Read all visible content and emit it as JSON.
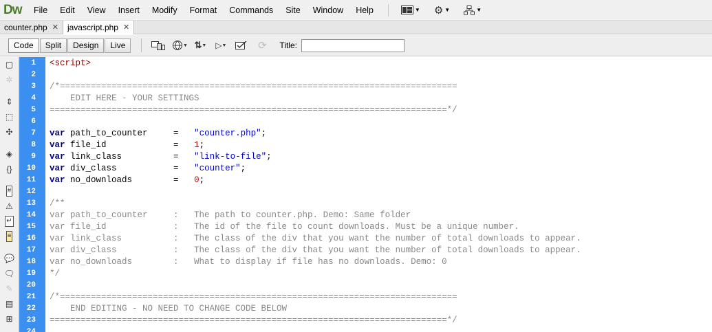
{
  "app": {
    "logo": "Dw",
    "menu": [
      "File",
      "Edit",
      "View",
      "Insert",
      "Modify",
      "Format",
      "Commands",
      "Site",
      "Window",
      "Help"
    ],
    "menu_icons": [
      "layout-icon",
      "gear-icon",
      "site-icon"
    ]
  },
  "tabs": [
    {
      "label": "counter.php",
      "active": false
    },
    {
      "label": "javascript.php",
      "active": true
    }
  ],
  "doc_toolbar": {
    "views": [
      "Code",
      "Split",
      "Design",
      "Live"
    ],
    "active_view": "Code",
    "title_label": "Title:",
    "title_value": ""
  },
  "editor": {
    "lines": [
      {
        "n": "1",
        "text": "<script>"
      },
      {
        "n": "2",
        "text": ""
      },
      {
        "n": "3",
        "text": "/*============================================================================="
      },
      {
        "n": "4",
        "text": "    EDIT HERE - YOUR SETTINGS"
      },
      {
        "n": "5",
        "text": "=============================================================================*/"
      },
      {
        "n": "6",
        "text": ""
      },
      {
        "n": "7",
        "kw": "var",
        "name": " path_to_counter     ",
        "eq": "=",
        "val": "\"counter.php\"",
        "valtype": "str",
        "end": ";"
      },
      {
        "n": "8",
        "kw": "var",
        "name": " file_id             ",
        "eq": "=",
        "val": "1",
        "valtype": "num",
        "end": ";"
      },
      {
        "n": "9",
        "kw": "var",
        "name": " link_class          ",
        "eq": "=",
        "val": "\"link-to-file\"",
        "valtype": "str",
        "end": ";"
      },
      {
        "n": "10",
        "kw": "var",
        "name": " div_class           ",
        "eq": "=",
        "val": "\"counter\"",
        "valtype": "str",
        "end": ";"
      },
      {
        "n": "11",
        "kw": "var",
        "name": " no_downloads        ",
        "eq": "=",
        "val": "0",
        "valtype": "num",
        "end": ";"
      },
      {
        "n": "12",
        "text": ""
      },
      {
        "n": "13",
        "text": "/**"
      },
      {
        "n": "14",
        "text": "var path_to_counter     :   The path to counter.php. Demo: Same folder"
      },
      {
        "n": "15",
        "text": "var file_id             :   The id of the file to count downloads. Must be a unique number."
      },
      {
        "n": "16",
        "text": "var link_class          :   The class of the div that you want the number of total downloads to appear."
      },
      {
        "n": "17",
        "text": "var div_class           :   The class of the div that you want the number of total downloads to appear."
      },
      {
        "n": "18",
        "text": "var no_downloads        :   What to display if file has no downloads. Demo: 0"
      },
      {
        "n": "19",
        "text": "*/"
      },
      {
        "n": "20",
        "text": ""
      },
      {
        "n": "21",
        "text": "/*============================================================================="
      },
      {
        "n": "22",
        "text": "    END EDITING - NO NEED TO CHANGE CODE BELOW"
      },
      {
        "n": "23",
        "text": "=============================================================================*/"
      },
      {
        "n": "24",
        "text": ""
      }
    ]
  }
}
